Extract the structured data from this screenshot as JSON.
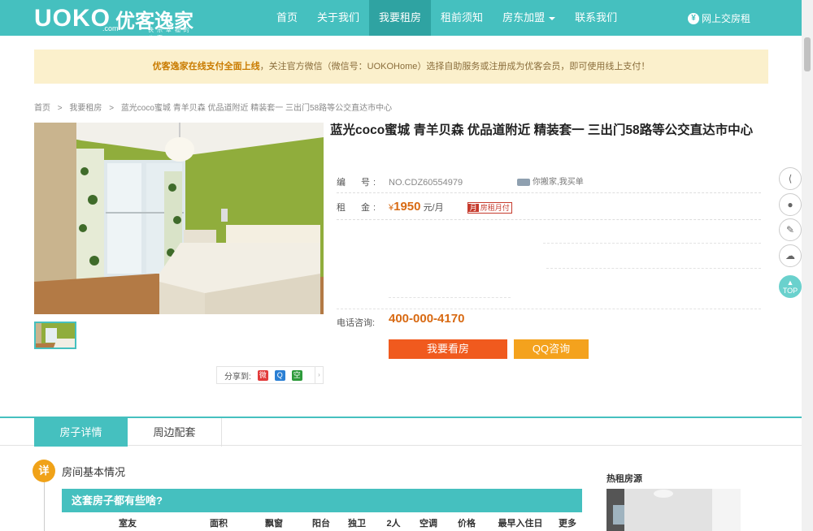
{
  "header": {
    "logo_latin": "UOKO",
    "logo_com": ".com",
    "logo_cn": "优客逸家",
    "logo_tag": "快 乐 幸 福 的 公 寓",
    "nav": [
      "首页",
      "关于我们",
      "我要租房",
      "租前须知",
      "房东加盟",
      "联系我们"
    ],
    "nav_active": "我要租房",
    "online_label": "网上交房租"
  },
  "notice": {
    "bold": "优客逸家在线支付全面上线",
    "text": "，关注官方微信（微信号：UOKOHome）选择自助服务或注册成为优客会员，即可使用线上支付！"
  },
  "breadcrumb": [
    "首页",
    ">",
    "我要租房",
    ">",
    "蓝光coco蜜城 青羊贝森 优品道附近 精装套一 三出门58路等公交直达市中心"
  ],
  "listing": {
    "title": "蓝光coco蜜城 青羊贝森 优品道附近 精装套一 三出门58路等公交直达市中心",
    "code_label": "编　号:",
    "code": "NO.CDZ60554979",
    "delivery_text": "你搬家,我买单",
    "rent_label": "租　金:",
    "currency": "¥",
    "price": "1950",
    "price_unit": "元/月",
    "badge_icon": "月",
    "badge_text": "房租月付",
    "tel_label": "电话咨询:",
    "tel": "400-000-4170",
    "btn_view": "我要看房",
    "btn_qq": "QQ咨询"
  },
  "share": {
    "label": "分享到:",
    "more": "›"
  },
  "side_tools": [
    "share-icon",
    "qq-icon",
    "notes-icon",
    "wechat-icon",
    "top-icon"
  ],
  "side_top_label": "TOP",
  "tabs": [
    "房子详情",
    "周边配套"
  ],
  "section": {
    "badge": "详",
    "title": "房间基本情况"
  },
  "detail": {
    "header": "这套房子都有些啥?",
    "columns": [
      "室友",
      "面积",
      "飘窗",
      "阳台",
      "独卫",
      "2人",
      "空调",
      "价格",
      "最早入住日",
      "更多"
    ]
  },
  "hot": {
    "title": "热租房源"
  },
  "colors": {
    "primary": "#45c0bf",
    "accent": "#f05a1e",
    "qq": "#f4a21d",
    "price": "#d86a13"
  }
}
